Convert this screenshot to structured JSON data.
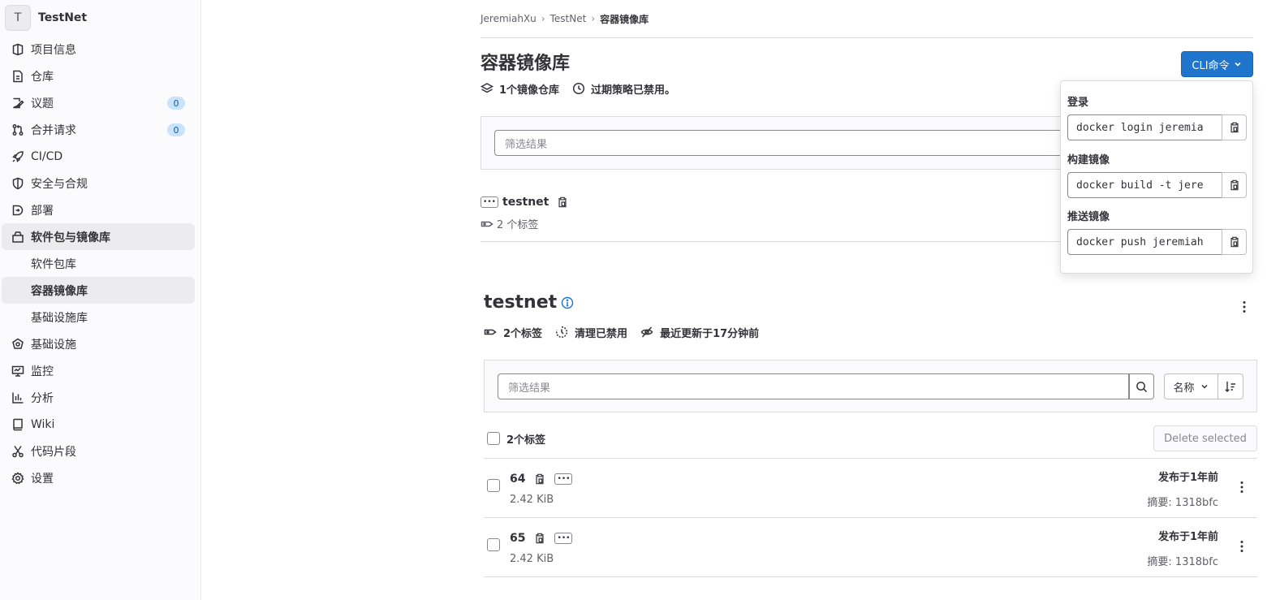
{
  "project": {
    "initial": "T",
    "name": "TestNet"
  },
  "sidebar": {
    "items": [
      {
        "label": "项目信息",
        "icon": "project-info-icon"
      },
      {
        "label": "仓库",
        "icon": "document-icon"
      },
      {
        "label": "议题",
        "icon": "issues-icon",
        "badge": "0"
      },
      {
        "label": "合并请求",
        "icon": "merge-request-icon",
        "badge": "0"
      },
      {
        "label": "CI/CD",
        "icon": "rocket-icon"
      },
      {
        "label": "安全与合规",
        "icon": "shield-icon"
      },
      {
        "label": "部署",
        "icon": "deployments-icon"
      },
      {
        "label": "软件包与镜像库",
        "icon": "package-icon"
      },
      {
        "label": "软件包库"
      },
      {
        "label": "容器镜像库"
      },
      {
        "label": "基础设施库"
      },
      {
        "label": "基础设施",
        "icon": "cloud-gear-icon"
      },
      {
        "label": "监控",
        "icon": "monitor-icon"
      },
      {
        "label": "分析",
        "icon": "chart-icon"
      },
      {
        "label": "Wiki",
        "icon": "book-icon"
      },
      {
        "label": "代码片段",
        "icon": "snippet-icon"
      },
      {
        "label": "设置",
        "icon": "settings-icon"
      }
    ]
  },
  "breadcrumb": [
    "JeremiahXu",
    "TestNet",
    "容器镜像库"
  ],
  "page": {
    "title": "容器镜像库",
    "repo_count": "1个镜像仓库",
    "expiration": "过期策略已禁用。",
    "cli_button": "CLI命令",
    "filter_placeholder": "筛选结果"
  },
  "repo": {
    "name": "testnet",
    "tags": "2 个标签"
  },
  "cli": {
    "login_label": "登录",
    "login_cmd": "docker login jeremia",
    "build_label": "构建镜像",
    "build_cmd": "docker build -t jere",
    "push_label": "推送镜像",
    "push_cmd": "docker push jeremiah"
  },
  "image": {
    "title": "testnet",
    "tag_count": "2个标签",
    "cleanup": "清理已禁用",
    "updated": "最近更新于17分钟前",
    "filter_placeholder": "筛选结果",
    "sort_label": "名称",
    "select_label": "2个标签",
    "delete_button": "Delete selected",
    "tags": [
      {
        "name": "64",
        "size": "2.42 KiB",
        "published": "发布于1年前",
        "digest": "摘要: 1318bfc"
      },
      {
        "name": "65",
        "size": "2.42 KiB",
        "published": "发布于1年前",
        "digest": "摘要: 1318bfc"
      }
    ]
  },
  "colors": {
    "primary": "#1f75cb",
    "badge_bg": "#cbe2f9",
    "badge_fg": "#0b5cad"
  }
}
